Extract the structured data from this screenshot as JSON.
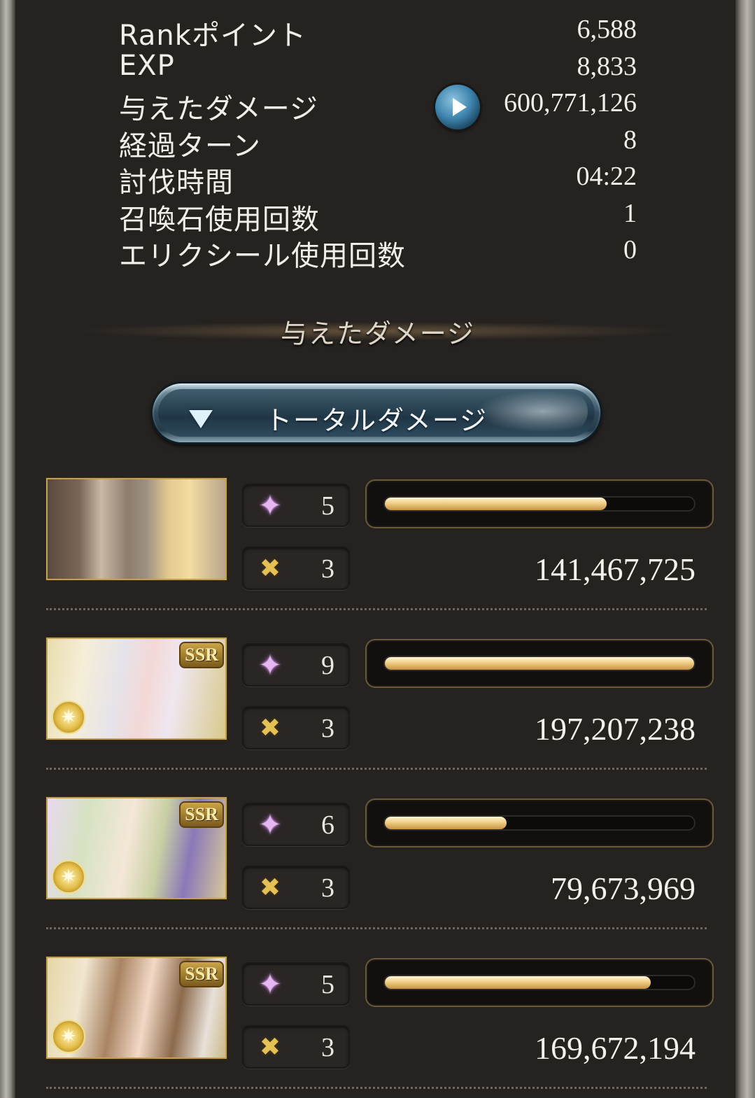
{
  "stats": [
    {
      "label": "Rankポイント",
      "value": "6,588"
    },
    {
      "label": "EXP",
      "value": "8,833"
    },
    {
      "label": "与えたダメージ",
      "value": "600,771,126"
    },
    {
      "label": "経過ターン",
      "value": "8"
    },
    {
      "label": "討伐時間",
      "value": "04:22"
    },
    {
      "label": "召喚石使用回数",
      "value": "1"
    },
    {
      "label": "エリクシール使用回数",
      "value": "0"
    }
  ],
  "section_title": "与えたダメージ",
  "dropdown": {
    "label": "トータルダメージ"
  },
  "members": [
    {
      "sparkle_count": "5",
      "swords_count": "3",
      "damage": "141,467,725",
      "bar_fraction": 0.72,
      "ssr": ""
    },
    {
      "sparkle_count": "9",
      "swords_count": "3",
      "damage": "197,207,238",
      "bar_fraction": 1.0,
      "ssr": "SSR"
    },
    {
      "sparkle_count": "6",
      "swords_count": "3",
      "damage": "79,673,969",
      "bar_fraction": 0.4,
      "ssr": "SSR"
    },
    {
      "sparkle_count": "5",
      "swords_count": "3",
      "damage": "169,672,194",
      "bar_fraction": 0.86,
      "ssr": "SSR"
    }
  ],
  "colors": {
    "bar_fill": "#f0cf86",
    "panel_bg": "#252220",
    "dropdown_accent": "#314b5c"
  },
  "icons": {
    "play": "play-icon",
    "sparkle": "sparkle-icon",
    "swords": "swords-icon",
    "caret": "caret-down-icon"
  }
}
